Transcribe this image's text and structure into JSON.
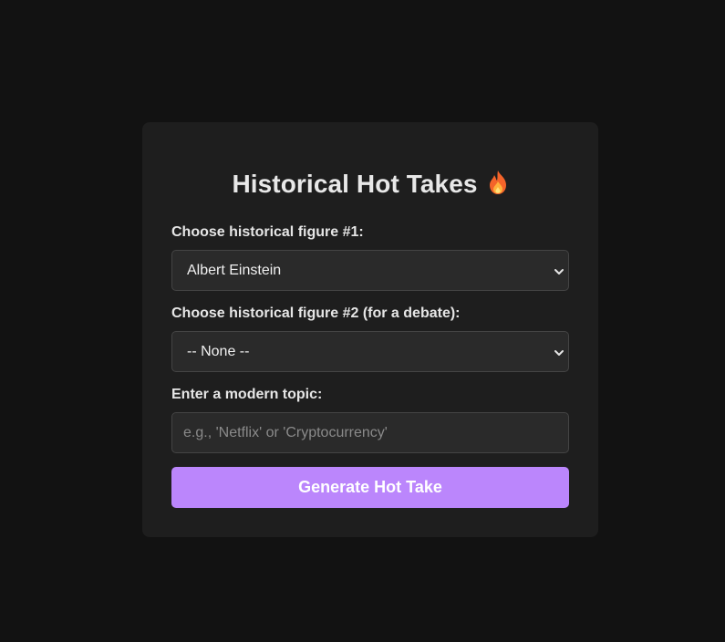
{
  "title": "Historical Hot Takes",
  "title_icon": "flame-icon",
  "figure1": {
    "label": "Choose historical figure #1:",
    "selected": "Albert Einstein"
  },
  "figure2": {
    "label": "Choose historical figure #2 (for a debate):",
    "selected": "-- None --"
  },
  "topic": {
    "label": "Enter a modern topic:",
    "value": "",
    "placeholder": "e.g., 'Netflix' or 'Cryptocurrency'"
  },
  "generate_button": "Generate Hot Take",
  "colors": {
    "background": "#121212",
    "card": "#1e1e1e",
    "field": "#2a2a2a",
    "accent": "#bb86fc"
  }
}
